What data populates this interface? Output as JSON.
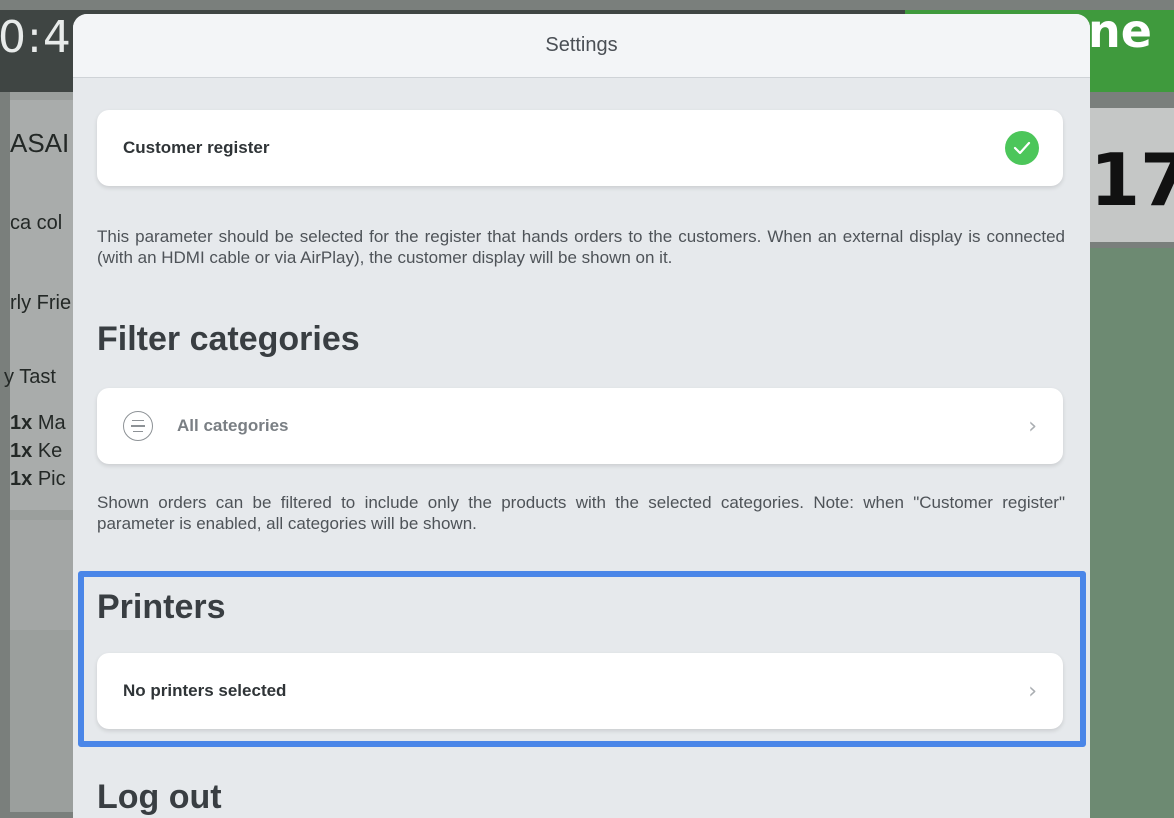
{
  "background": {
    "time": "0:4",
    "done": "ne",
    "ticket_number": "17",
    "lines": [
      "ASAI",
      "ca col",
      "rly Frie",
      "y Tast"
    ],
    "items": [
      {
        "qty": "1x",
        "name": "Ma"
      },
      {
        "qty": "1x",
        "name": "Ke"
      },
      {
        "qty": "1x",
        "name": "Pic"
      }
    ]
  },
  "modal": {
    "title": "Settings",
    "customer_register": {
      "label": "Customer register",
      "checked": true,
      "description": "This parameter should be selected for the register that hands orders to the customers. When an external display is connected (with an HDMI cable or via AirPlay), the customer display will be shown on it."
    },
    "filter_categories": {
      "heading": "Filter categories",
      "label": "All categories",
      "description": "Shown orders can be filtered to include only the products with the selected categories. Note: when \"Customer register\" parameter is enabled, all categories will be shown."
    },
    "printers": {
      "heading": "Printers",
      "label": "No printers selected"
    },
    "logout": {
      "heading": "Log out"
    }
  },
  "colors": {
    "check_green": "#4cc65a",
    "highlight_blue": "#4a86e8"
  }
}
